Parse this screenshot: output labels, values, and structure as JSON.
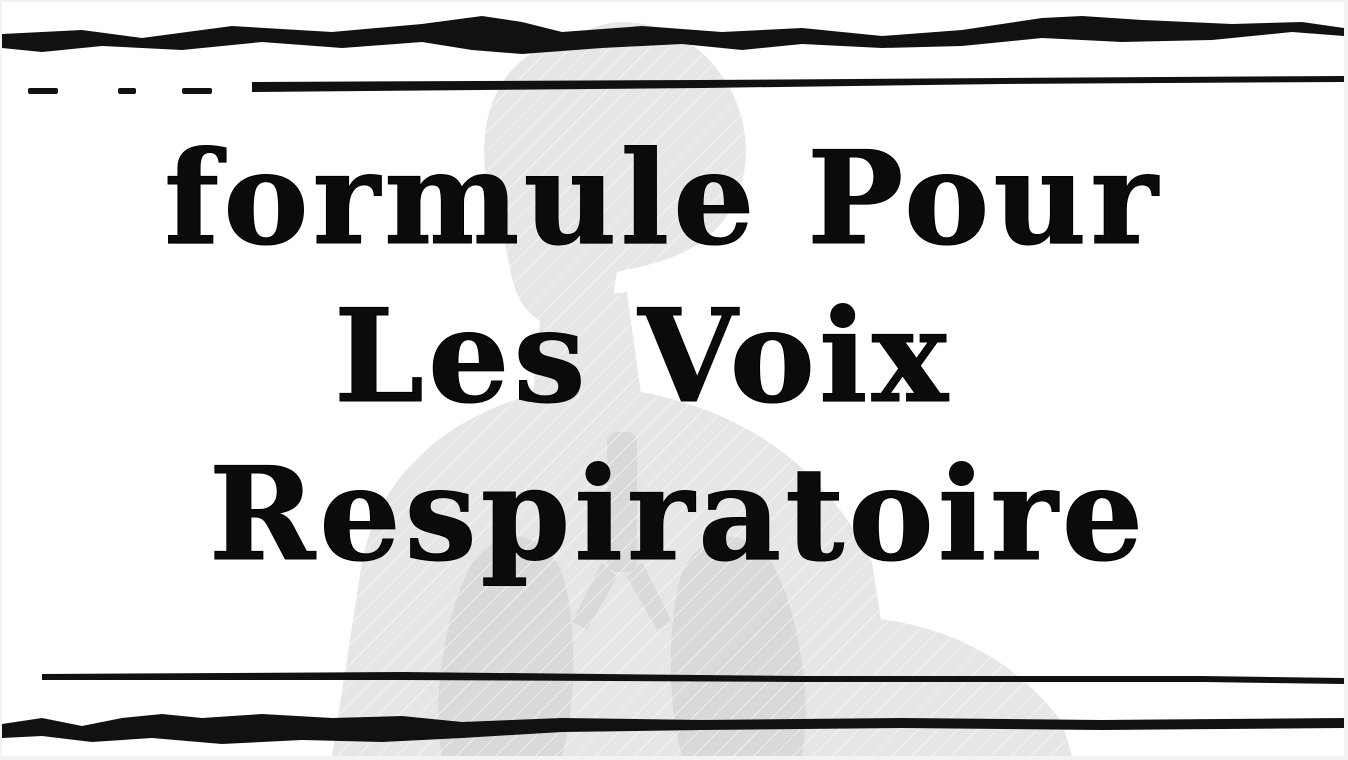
{
  "slide": {
    "title_lines": [
      "formule Pour",
      "Les Voix",
      "Respiratoire"
    ],
    "background_color": "#ffffff",
    "text_color": "#0b0b0b",
    "silhouette_color": "#e4e4e4",
    "silhouette_icon": "human-lungs-silhouette-icon",
    "border_style": "grunge-brush-stripes"
  }
}
